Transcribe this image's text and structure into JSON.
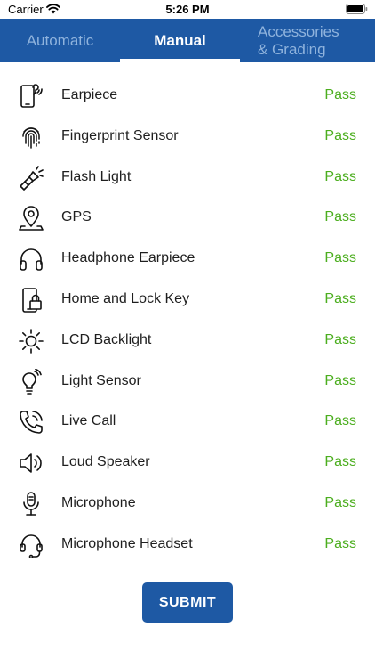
{
  "status_bar": {
    "carrier": "Carrier",
    "time": "5:26 PM"
  },
  "tabs": [
    {
      "label": "Automatic"
    },
    {
      "label": "Manual"
    },
    {
      "label_line1": "Accessories",
      "label_line2": "& Grading"
    }
  ],
  "tests": [
    {
      "label": "Earpiece",
      "status": "Pass",
      "icon": "earpiece-icon"
    },
    {
      "label": "Fingerprint Sensor",
      "status": "Pass",
      "icon": "fingerprint-icon"
    },
    {
      "label": "Flash Light",
      "status": "Pass",
      "icon": "flashlight-icon"
    },
    {
      "label": "GPS",
      "status": "Pass",
      "icon": "gps-icon"
    },
    {
      "label": "Headphone Earpiece",
      "status": "Pass",
      "icon": "headphone-icon"
    },
    {
      "label": "Home and Lock Key",
      "status": "Pass",
      "icon": "lock-key-icon"
    },
    {
      "label": "LCD Backlight",
      "status": "Pass",
      "icon": "backlight-icon"
    },
    {
      "label": "Light Sensor",
      "status": "Pass",
      "icon": "light-sensor-icon"
    },
    {
      "label": "Live Call",
      "status": "Pass",
      "icon": "live-call-icon"
    },
    {
      "label": "Loud Speaker",
      "status": "Pass",
      "icon": "speaker-icon"
    },
    {
      "label": "Microphone",
      "status": "Pass",
      "icon": "microphone-icon"
    },
    {
      "label": "Microphone Headset",
      "status": "Pass",
      "icon": "headset-icon"
    }
  ],
  "submit_label": "SUBMIT",
  "colors": {
    "brand": "#1e59a4",
    "pass": "#4cae1f",
    "inactive_tab": "#8fb3dd"
  }
}
